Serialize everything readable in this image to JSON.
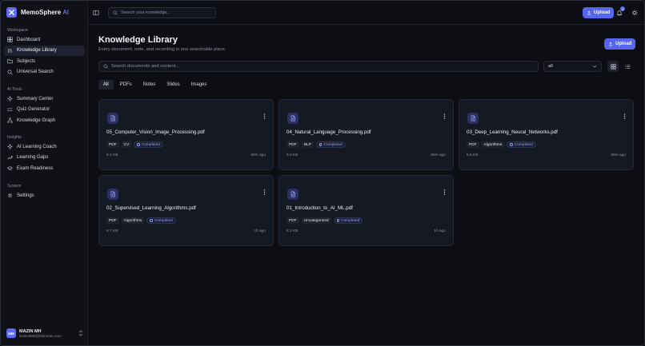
{
  "app": {
    "name": "MemoSphere",
    "name_suffix": "AI"
  },
  "sidebar": {
    "sections": [
      {
        "heading": "Workspace",
        "items": [
          {
            "label": "Dashboard",
            "icon": "dashboard-icon"
          },
          {
            "label": "Knowledge Library",
            "icon": "library-icon",
            "active": true
          },
          {
            "label": "Subjects",
            "icon": "folder-icon"
          },
          {
            "label": "Universal Search",
            "icon": "search-icon"
          }
        ]
      },
      {
        "heading": "AI Tools",
        "items": [
          {
            "label": "Summary Center",
            "icon": "sparkle-icon"
          },
          {
            "label": "Quiz Generator",
            "icon": "checklist-icon"
          },
          {
            "label": "Knowledge Graph",
            "icon": "graph-icon"
          }
        ]
      },
      {
        "heading": "Insights",
        "items": [
          {
            "label": "AI Learning Coach",
            "icon": "sparkle-icon"
          },
          {
            "label": "Learning Gaps",
            "icon": "trend-icon"
          },
          {
            "label": "Exam Readiness",
            "icon": "graduation-cap-icon"
          }
        ]
      },
      {
        "heading": "System",
        "items": [
          {
            "label": "Settings",
            "icon": "gear-icon"
          }
        ]
      }
    ],
    "user": {
      "initials": "MM",
      "name": "MAZIN MH",
      "email": "ismlei385@fishmone.com"
    }
  },
  "topbar": {
    "search_placeholder": "Search your knowledge...",
    "upload_label": "Upload",
    "notification_count": "3"
  },
  "main": {
    "title": "Knowledge Library",
    "subtitle": "Every document, note, and recording in one searchable place.",
    "upload_label": "Upload",
    "search_placeholder": "Search documents and content...",
    "filter_value": "all",
    "tabs": [
      {
        "label": "All",
        "active": true
      },
      {
        "label": "PDFs"
      },
      {
        "label": "Notes"
      },
      {
        "label": "Slides"
      },
      {
        "label": "Images"
      }
    ],
    "documents": [
      {
        "name": "05_Computer_Vision_Image_Processing.pdf",
        "type": "PDF",
        "subject": "CV",
        "status": "Completed",
        "size": "6.2 KB",
        "time": "59m ago"
      },
      {
        "name": "04_Natural_Language_Processing.pdf",
        "type": "PDF",
        "subject": "NLP",
        "status": "Completed",
        "size": "6.0 KB",
        "time": "59m ago"
      },
      {
        "name": "03_Deep_Learning_Neural_Networks.pdf",
        "type": "PDF",
        "subject": "Algorithms",
        "status": "Completed",
        "size": "5.6 KB",
        "time": "59m ago"
      },
      {
        "name": "02_Supervised_Learning_Algorithms.pdf",
        "type": "PDF",
        "subject": "Algorithms",
        "status": "Completed",
        "size": "6.7 KB",
        "time": "1h ago"
      },
      {
        "name": "01_Introduction_to_AI_ML.pdf",
        "type": "PDF",
        "subject": "Uncategorized",
        "status": "Completed",
        "size": "6.1 KB",
        "time": "1h ago"
      }
    ]
  },
  "colors": {
    "accent": "#5565ee",
    "background": "#0c0e13",
    "card": "#151923",
    "status_text": "#8c9bff"
  }
}
